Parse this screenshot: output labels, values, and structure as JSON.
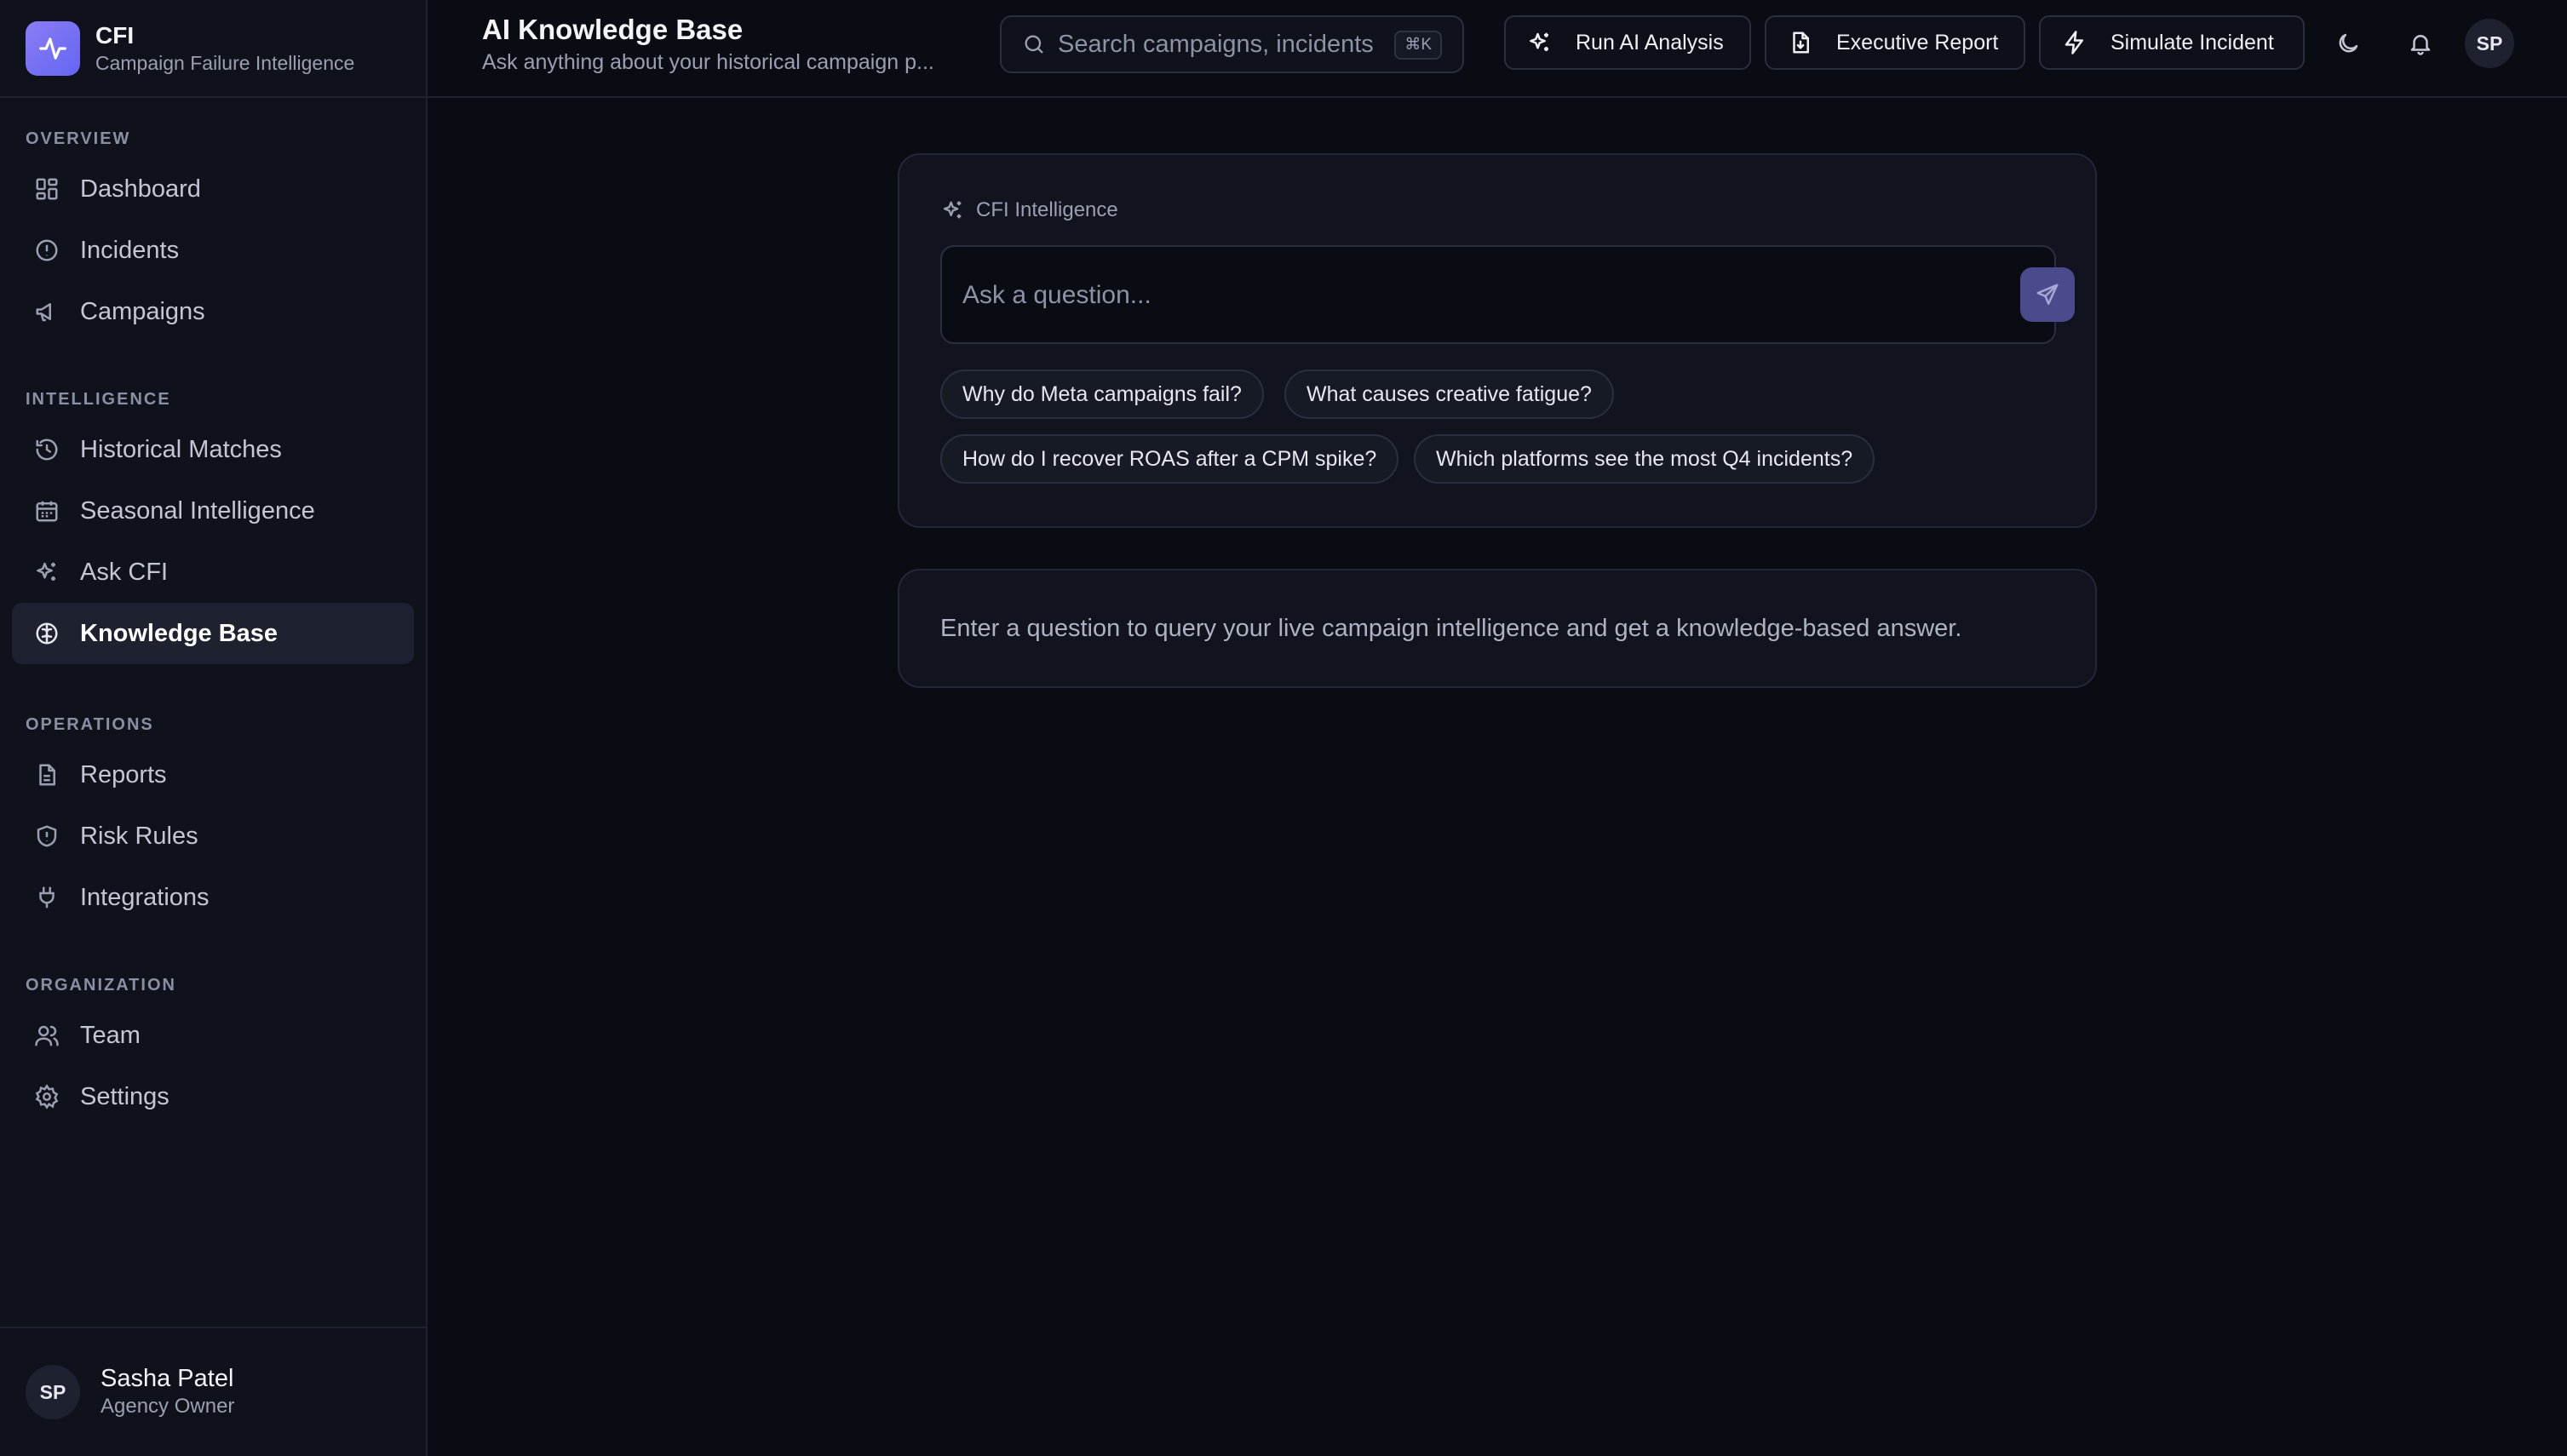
{
  "brand": {
    "name": "CFI",
    "subtitle": "Campaign Failure Intelligence",
    "logo_icon": "pulse-icon",
    "accent": "#8b7cf6"
  },
  "sidebar": {
    "sections": [
      {
        "heading": "OVERVIEW",
        "items": [
          {
            "label": "Dashboard",
            "icon": "dashboard-icon"
          },
          {
            "label": "Incidents",
            "icon": "alert-circle-icon"
          },
          {
            "label": "Campaigns",
            "icon": "megaphone-icon"
          }
        ]
      },
      {
        "heading": "INTELLIGENCE",
        "items": [
          {
            "label": "Historical Matches",
            "icon": "history-icon"
          },
          {
            "label": "Seasonal Intelligence",
            "icon": "calendar-icon"
          },
          {
            "label": "Ask CFI",
            "icon": "sparkles-icon"
          },
          {
            "label": "Knowledge Base",
            "icon": "brain-icon",
            "active": true
          }
        ]
      },
      {
        "heading": "OPERATIONS",
        "items": [
          {
            "label": "Reports",
            "icon": "file-icon"
          },
          {
            "label": "Risk Rules",
            "icon": "shield-icon"
          },
          {
            "label": "Integrations",
            "icon": "plug-icon"
          }
        ]
      },
      {
        "heading": "ORGANIZATION",
        "items": [
          {
            "label": "Team",
            "icon": "users-icon"
          },
          {
            "label": "Settings",
            "icon": "gear-icon"
          }
        ]
      }
    ],
    "user": {
      "initials": "SP",
      "name": "Sasha Patel",
      "role": "Agency Owner"
    }
  },
  "header": {
    "title": "AI Knowledge Base",
    "subtitle": "Ask anything about your historical campaign p...",
    "search": {
      "placeholder": "Search campaigns, incidents",
      "shortcut": "⌘K"
    },
    "buttons": {
      "run_ai": "Run AI Analysis",
      "executive_report": "Executive Report",
      "simulate": "Simulate Incident"
    },
    "avatar_initials": "SP"
  },
  "main": {
    "card_label": "CFI Intelligence",
    "question_placeholder": "Ask a question...",
    "suggestions": [
      "Why do Meta campaigns fail?",
      "What causes creative fatigue?",
      "How do I recover ROAS after a CPM spike?",
      "Which platforms see the most Q4 incidents?"
    ],
    "empty_state": "Enter a question to query your live campaign intelligence and get a knowledge-based answer."
  }
}
